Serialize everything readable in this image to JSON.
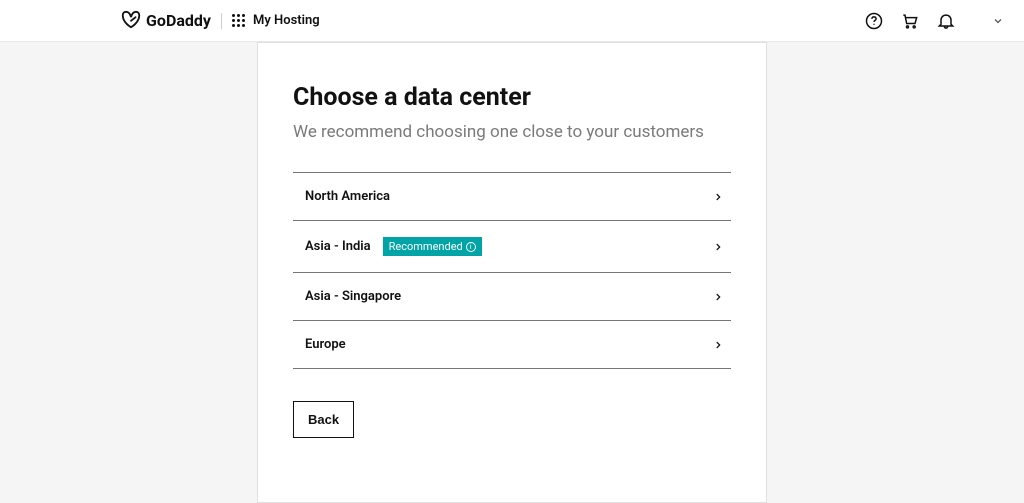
{
  "header": {
    "brand": "GoDaddy",
    "page_name": "My Hosting"
  },
  "card": {
    "title": "Choose a data center",
    "subtitle": "We recommend choosing one close to your customers",
    "options": [
      {
        "label": "North America",
        "recommended": false
      },
      {
        "label": "Asia - India",
        "recommended": true,
        "badge": "Recommended"
      },
      {
        "label": "Asia - Singapore",
        "recommended": false
      },
      {
        "label": "Europe",
        "recommended": false
      }
    ],
    "back_label": "Back"
  },
  "colors": {
    "accent": "#00a4a6"
  }
}
